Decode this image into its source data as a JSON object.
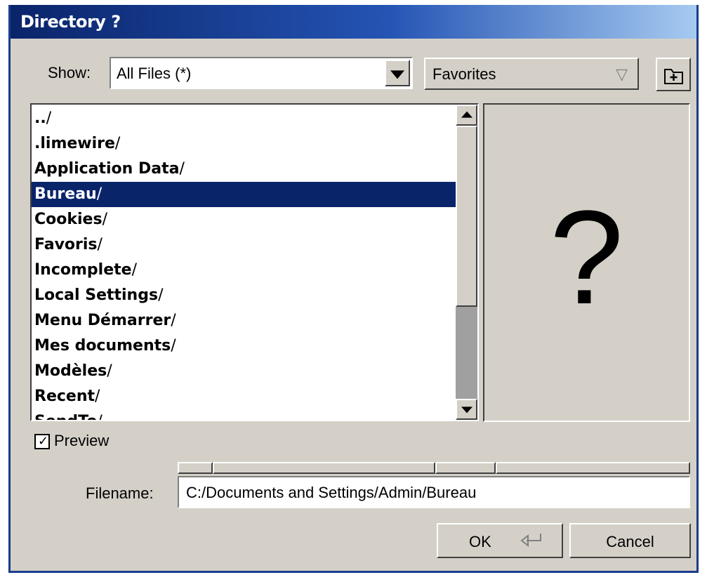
{
  "window": {
    "title": "Directory ?"
  },
  "show": {
    "label": "Show:",
    "value": "All Files (*)"
  },
  "favorites": {
    "label": "Favorites",
    "arrow": "▽"
  },
  "new_folder_icon": "new-folder-icon",
  "files": {
    "items": [
      {
        "name": "..",
        "slash": "/"
      },
      {
        "name": ".limewire",
        "slash": "/"
      },
      {
        "name": "Application Data",
        "slash": "/"
      },
      {
        "name": "Bureau",
        "slash": "/",
        "selected": true
      },
      {
        "name": "Cookies",
        "slash": "/"
      },
      {
        "name": "Favoris",
        "slash": "/"
      },
      {
        "name": "Incomplete",
        "slash": "/"
      },
      {
        "name": "Local Settings",
        "slash": "/"
      },
      {
        "name": "Menu Démarrer",
        "slash": "/"
      },
      {
        "name": "Mes documents",
        "slash": "/"
      },
      {
        "name": "Modèles",
        "slash": "/"
      },
      {
        "name": "Recent",
        "slash": "/"
      },
      {
        "name": "SendTo",
        "slash": "/"
      }
    ]
  },
  "preview": {
    "placeholder": "?",
    "checkbox_label": "Preview",
    "checked": true
  },
  "filename": {
    "label": "Filename:",
    "value": "C:/Documents and Settings/Admin/Bureau"
  },
  "buttons": {
    "ok": "OK",
    "cancel": "Cancel"
  },
  "colors": {
    "selection": "#0a246a",
    "title_bar": "#0a246a",
    "face": "#d4d0c8"
  }
}
